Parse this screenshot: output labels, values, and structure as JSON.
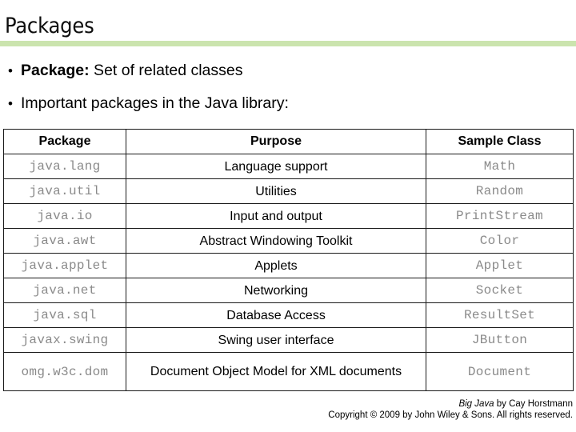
{
  "slide": {
    "title": "Packages",
    "accent_color": "#cbe4ae",
    "mono_text_color": "#8a8a8a"
  },
  "bullets": [
    {
      "marker": "•",
      "strong": "Package:",
      "rest": " Set of related classes"
    },
    {
      "marker": "•",
      "strong": "",
      "rest": "Important packages in the Java library:"
    }
  ],
  "table": {
    "headers": [
      "Package",
      "Purpose",
      "Sample Class"
    ],
    "rows": [
      {
        "package": "java.lang",
        "purpose": "Language support",
        "sample": "Math"
      },
      {
        "package": "java.util",
        "purpose": "Utilities",
        "sample": "Random"
      },
      {
        "package": "java.io",
        "purpose": "Input and output",
        "sample": "PrintStream"
      },
      {
        "package": "java.awt",
        "purpose": "Abstract Windowing Toolkit",
        "sample": "Color"
      },
      {
        "package": "java.applet",
        "purpose": "Applets",
        "sample": "Applet"
      },
      {
        "package": "java.net",
        "purpose": "Networking",
        "sample": "Socket"
      },
      {
        "package": "java.sql",
        "purpose": "Database Access",
        "sample": "ResultSet"
      },
      {
        "package": "javax.swing",
        "purpose": "Swing user interface",
        "sample": "JButton"
      },
      {
        "package": "omg.w3c.dom",
        "purpose": "Document Object Model for XML documents",
        "sample": "Document"
      }
    ]
  },
  "footer": {
    "book_title": "Big Java",
    "byline": " by Cay Horstmann",
    "copyright": "Copyright © 2009 by John Wiley & Sons.  All rights reserved."
  }
}
